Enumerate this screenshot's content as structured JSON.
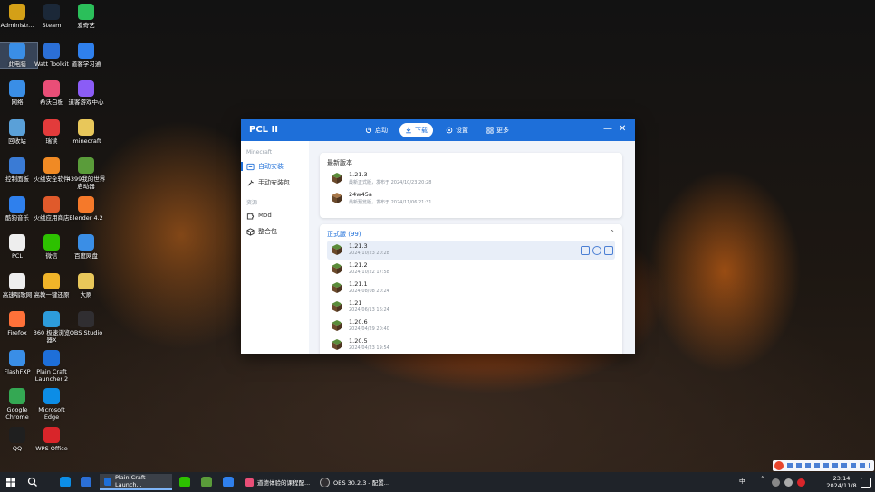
{
  "desktop": {
    "icons": [
      {
        "label": "Administr...",
        "color": "#d4a017"
      },
      {
        "label": "Steam",
        "color": "#1b2838"
      },
      {
        "label": "爱奇艺",
        "color": "#2bbf5a"
      },
      {
        "label": "此电脑",
        "color": "#3a8ee6"
      },
      {
        "label": "Watt Toolkit",
        "color": "#2b6fd6"
      },
      {
        "label": "道客学习通",
        "color": "#2f80ed"
      },
      {
        "label": "网络",
        "color": "#3a8ee6"
      },
      {
        "label": "希沃白板",
        "color": "#e94e77"
      },
      {
        "label": "道客游戏中心",
        "color": "#8b5cf6"
      },
      {
        "label": "回收站",
        "color": "#5aa0d8"
      },
      {
        "label": "瑞读",
        "color": "#e33b3b"
      },
      {
        "label": ".minecraft",
        "color": "#e8c75a"
      },
      {
        "label": "控制面板",
        "color": "#3a7bd5"
      },
      {
        "label": "火绒安全软件",
        "color": "#f08a24"
      },
      {
        "label": "4399我的世界启动器",
        "color": "#5a9c3a"
      },
      {
        "label": "酷狗音乐",
        "color": "#2f80ed"
      },
      {
        "label": "火绒应用商店",
        "color": "#e05a2b"
      },
      {
        "label": "Blender 4.2",
        "color": "#f5792a"
      },
      {
        "label": "PCL",
        "color": "#eeeeee"
      },
      {
        "label": "微信",
        "color": "#2dc100"
      },
      {
        "label": "百度网盘",
        "color": "#3a8ee6"
      },
      {
        "label": "高速唱歌网",
        "color": "#eeeeee"
      },
      {
        "label": "高教一键还原",
        "color": "#f0b429"
      },
      {
        "label": "大刷",
        "color": "#e8c75a"
      },
      {
        "label": "Firefox",
        "color": "#ff7139"
      },
      {
        "label": "360 极速浏览器X",
        "color": "#2d9cdb"
      },
      {
        "label": "OBS Studio",
        "color": "#302e31"
      },
      {
        "label": "FlashFXP",
        "color": "#3a8ee6"
      },
      {
        "label": "Plain Craft Launcher 2",
        "color": "#1e6fd9"
      },
      {
        "label": "Google Chrome",
        "color": "#34a853"
      },
      {
        "label": "Microsoft Edge",
        "color": "#0c8de6"
      },
      {
        "label": "QQ",
        "color": "#1f1f1f"
      },
      {
        "label": "WPS Office",
        "color": "#d9252a"
      }
    ]
  },
  "window": {
    "title": "PCL II",
    "nav": [
      {
        "label": "启动",
        "icon": "power-icon"
      },
      {
        "label": "下载",
        "icon": "download-icon",
        "active": true
      },
      {
        "label": "设置",
        "icon": "settings-icon"
      },
      {
        "label": "更多",
        "icon": "grid-icon"
      }
    ],
    "controls": {
      "minimize": "—",
      "close": "✕"
    },
    "sidebar": {
      "section1": "Minecraft",
      "section2": "资源",
      "items": [
        {
          "label": "自动安装",
          "icon": "install-icon",
          "active": true
        },
        {
          "label": "手动安装包",
          "icon": "wrench-icon"
        },
        {
          "label": "Mod",
          "icon": "puzzle-icon"
        },
        {
          "label": "整合包",
          "icon": "cube-icon"
        }
      ]
    },
    "latest": {
      "title": "最新版本",
      "items": [
        {
          "name": "1.21.3",
          "sub": "最新正式版，发布于 2024/10/23 20:28",
          "color": "#5a8c3a"
        },
        {
          "name": "24w45a",
          "sub": "最新预览版，发布于 2024/11/06 21:31",
          "color": "#a8784a"
        }
      ]
    },
    "release": {
      "title": "正式版 (99)",
      "collapse": "⌃",
      "items": [
        {
          "name": "1.21.3",
          "sub": "2024/10/23 20:28"
        },
        {
          "name": "1.21.2",
          "sub": "2024/10/22 17:58"
        },
        {
          "name": "1.21.1",
          "sub": "2024/08/08 20:24"
        },
        {
          "name": "1.21",
          "sub": "2024/06/13 16:24"
        },
        {
          "name": "1.20.6",
          "sub": "2024/04/29 20:40"
        },
        {
          "name": "1.20.5",
          "sub": "2024/04/23 19:54"
        }
      ]
    }
  },
  "taskbar": {
    "apps": [
      {
        "label": "Plain Craft Launch...",
        "active": true,
        "color": "#1e6fd9"
      },
      {
        "label": "道德体验的课程配...",
        "active": false,
        "color": "#e94e77"
      },
      {
        "label": "OBS 30.2.3 - 配置...",
        "active": false,
        "color": "#302e31"
      }
    ],
    "tray_lang": "中",
    "time": "23:14",
    "date": "2024/11/8"
  }
}
